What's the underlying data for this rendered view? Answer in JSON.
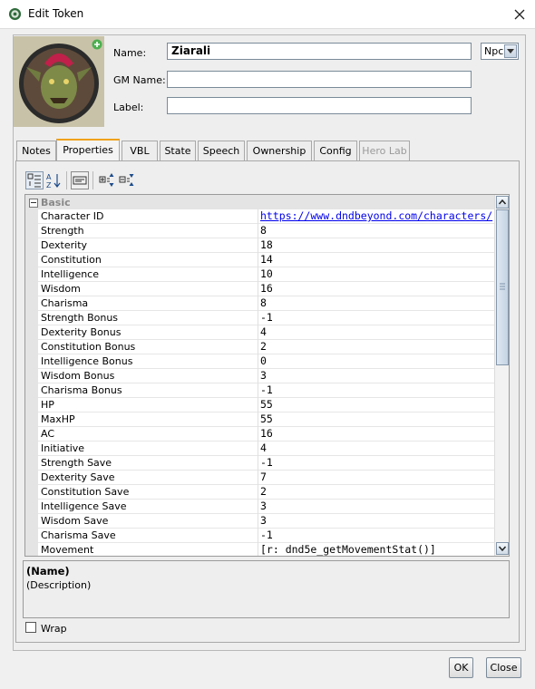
{
  "window": {
    "title": "Edit Token"
  },
  "header": {
    "name_label": "Name:",
    "name_value": "Ziarali",
    "gm_name_label": "GM Name:",
    "gm_name_value": "",
    "label_label": "Label:",
    "label_value": "",
    "type_select": {
      "selected": "Npc"
    }
  },
  "tabs": [
    {
      "label": "Notes",
      "state": "normal"
    },
    {
      "label": "Properties",
      "state": "active"
    },
    {
      "label": "VBL",
      "state": "normal"
    },
    {
      "label": "State",
      "state": "normal"
    },
    {
      "label": "Speech",
      "state": "normal"
    },
    {
      "label": "Ownership",
      "state": "normal"
    },
    {
      "label": "Config",
      "state": "normal"
    },
    {
      "label": "Hero Lab",
      "state": "disabled"
    }
  ],
  "toolbar_icons": [
    "categorized-view-icon",
    "sort-alphabetical-icon",
    "show-description-icon",
    "expand-all-icon",
    "collapse-all-icon"
  ],
  "properties": {
    "category": "Basic",
    "rows": [
      {
        "name": "Character ID",
        "value": "https://www.dndbeyond.com/characters/"
      },
      {
        "name": "Strength",
        "value": "8"
      },
      {
        "name": "Dexterity",
        "value": "18"
      },
      {
        "name": "Constitution",
        "value": "14"
      },
      {
        "name": "Intelligence",
        "value": "10"
      },
      {
        "name": "Wisdom",
        "value": "16"
      },
      {
        "name": "Charisma",
        "value": "8"
      },
      {
        "name": "Strength Bonus",
        "value": "-1"
      },
      {
        "name": "Dexterity Bonus",
        "value": "4"
      },
      {
        "name": "Constitution Bonus",
        "value": "2"
      },
      {
        "name": "Intelligence Bonus",
        "value": "0"
      },
      {
        "name": "Wisdom Bonus",
        "value": "3"
      },
      {
        "name": "Charisma Bonus",
        "value": "-1"
      },
      {
        "name": "HP",
        "value": "55"
      },
      {
        "name": "MaxHP",
        "value": "55"
      },
      {
        "name": "AC",
        "value": "16"
      },
      {
        "name": "Initiative",
        "value": "4"
      },
      {
        "name": "Strength Save",
        "value": "-1"
      },
      {
        "name": "Dexterity Save",
        "value": "7"
      },
      {
        "name": "Constitution Save",
        "value": "2"
      },
      {
        "name": "Intelligence Save",
        "value": "3"
      },
      {
        "name": "Wisdom Save",
        "value": "3"
      },
      {
        "name": "Charisma Save",
        "value": "-1"
      },
      {
        "name": "Movement",
        "value": "[r: dnd5e_getMovementStat()]"
      }
    ]
  },
  "description": {
    "name": "(Name)",
    "text": "(Description)"
  },
  "wrap": {
    "label": "Wrap",
    "checked": false
  },
  "buttons": {
    "ok": "OK",
    "close": "Close"
  },
  "colors": {
    "active_tab_accent": "#f0a11a",
    "link": "#0000ee"
  }
}
